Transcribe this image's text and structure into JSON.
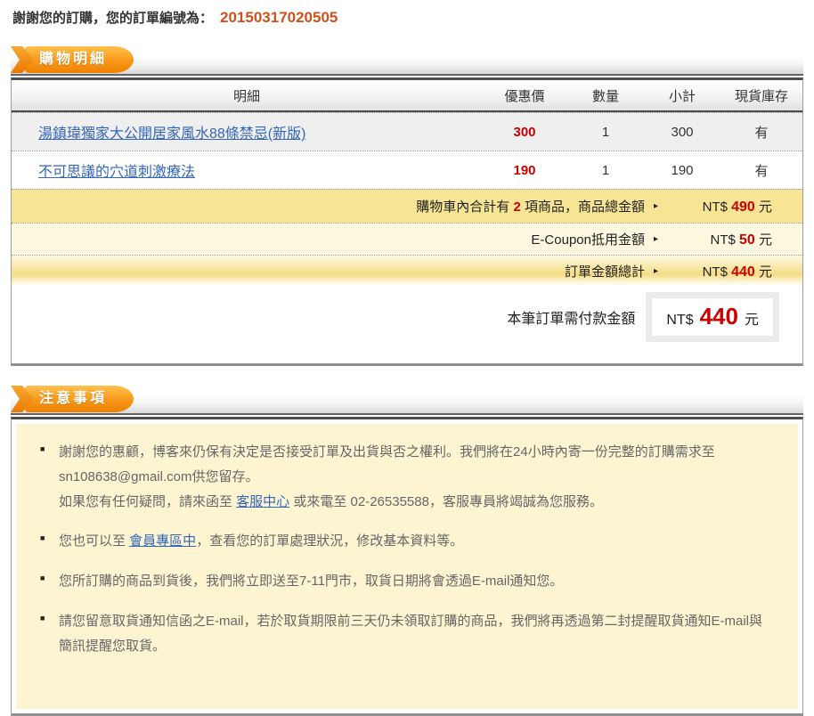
{
  "colors": {
    "accent_orange": "#ee8100",
    "order_number_orange": "#d0511d",
    "price_red": "#cc0000",
    "link_blue": "#3366bb",
    "summary_yellow": "#f7e494",
    "notice_yellow": "#fdf5d2"
  },
  "header": {
    "thanks_text": "謝謝您的訂購，您的訂單編號為：",
    "order_number": "20150317020505"
  },
  "cart": {
    "section_title": "購物明細",
    "columns": [
      "明細",
      "優惠價",
      "數量",
      "小計",
      "現貨庫存"
    ],
    "rows": [
      {
        "title": "湯鎮瑋獨家大公開居家風水88條禁忌(新版)",
        "price": "300",
        "qty": "1",
        "subtotal": "300",
        "stock": "有"
      },
      {
        "title": "不可思議的穴道刺激療法",
        "price": "190",
        "qty": "1",
        "subtotal": "190",
        "stock": "有"
      }
    ],
    "summary": {
      "total_items": {
        "label_pre": "購物車內合計有",
        "count": "2",
        "label_post": "項商品，商品總金額",
        "arrow": "▸",
        "currency": "NT$",
        "amount": "490",
        "unit": "元"
      },
      "ecoupon": {
        "label": "E-Coupon抵用金額",
        "arrow": "▸",
        "currency": "NT$",
        "amount": "50",
        "unit": "元"
      },
      "order_total": {
        "label": "訂單金額總計",
        "arrow": "▸",
        "currency": "NT$",
        "amount": "440",
        "unit": "元"
      },
      "payment_due": {
        "label": "本筆訂單需付款金額",
        "currency": "NT$",
        "amount": "440",
        "unit": "元"
      }
    }
  },
  "notice": {
    "section_title": "注意事項",
    "items": {
      "n1": {
        "line1": "謝謝您的惠顧，博客來仍保有決定是否接受訂單及出貨與否之權利。我們將在24小時內寄一份完整的訂購需求至sn108638@gmail.com供您留存。",
        "line2_pre": "如果您有任何疑問，請來函至 ",
        "link": "客服中心",
        "line2_post": " 或來電至 02-26535588，客服專員將竭誠為您服務。"
      },
      "n2": {
        "pre": "您也可以至 ",
        "link": "會員專區中",
        "post": "，查看您的訂單處理狀況，修改基本資料等。"
      },
      "n3": {
        "text": "您所訂購的商品到貨後，我們將立即送至7-11門市，取貨日期將會透過E-mail通知您。"
      },
      "n4": {
        "text": "請您留意取貨通知信函之E-mail，若於取貨期限前三天仍未領取訂購的商品，我們將再透過第二封提醒取貨通知E-mail與簡訊提醒您取貨。"
      }
    }
  }
}
